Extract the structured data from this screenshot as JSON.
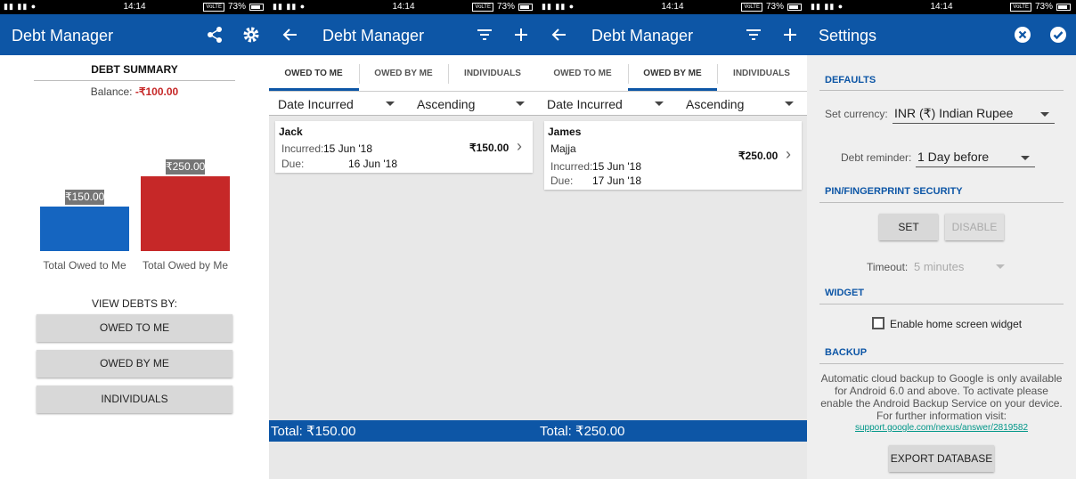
{
  "status_bar": {
    "time": "14:14",
    "battery": "73%",
    "volte": "VoLTE"
  },
  "summary_screen": {
    "app_title": "Debt Manager",
    "heading": "DEBT SUMMARY",
    "balance_label": "Balance:",
    "balance_value": "-₹100.00",
    "view_by_label": "VIEW DEBTS BY:",
    "buttons": [
      "OWED TO ME",
      "OWED BY ME",
      "INDIVIDUALS"
    ],
    "icons": [
      "share-icon",
      "gear-icon"
    ]
  },
  "chart_data": {
    "type": "bar",
    "categories": [
      "Total Owed to Me",
      "Total Owed by Me"
    ],
    "values": [
      150,
      250
    ],
    "value_labels": [
      "₹150.00",
      "₹250.00"
    ],
    "colors": [
      "#1565c0",
      "#c62828"
    ],
    "ylim": [
      0,
      250
    ],
    "grid": false
  },
  "list_screens": [
    {
      "app_title": "Debt Manager",
      "tabs": [
        "OWED TO ME",
        "OWED BY ME",
        "INDIVIDUALS"
      ],
      "active_tab": 0,
      "sort_field": "Date Incurred",
      "sort_order": "Ascending",
      "item": {
        "name": "Jack",
        "incurred_label": "Incurred:",
        "incurred": "15 Jun '18",
        "due_label": "Due:",
        "due": "16 Jun '18",
        "amount": "₹150.00"
      },
      "total": "Total: ₹150.00"
    },
    {
      "app_title": "Debt Manager",
      "tabs": [
        "OWED TO ME",
        "OWED BY ME",
        "INDIVIDUALS"
      ],
      "active_tab": 1,
      "sort_field": "Date Incurred",
      "sort_order": "Ascending",
      "item": {
        "name": "James",
        "note": "Majja",
        "incurred_label": "Incurred:",
        "incurred": "15 Jun '18",
        "due_label": "Due:",
        "due": "17 Jun '18",
        "amount": "₹250.00"
      },
      "total": "Total: ₹250.00"
    }
  ],
  "settings_screen": {
    "title": "Settings",
    "defaults_heading": "DEFAULTS",
    "currency_label": "Set currency:",
    "currency_value": "INR (₹) Indian Rupee",
    "reminder_label": "Debt reminder:",
    "reminder_value": "1 Day before",
    "security_heading": "PIN/FINGERPRINT SECURITY",
    "set_button": "SET",
    "disable_button": "DISABLE",
    "timeout_label": "Timeout:",
    "timeout_value": "5 minutes",
    "widget_heading": "WIDGET",
    "widget_checkbox_label": "Enable home screen widget",
    "widget_checked": false,
    "backup_heading": "BACKUP",
    "backup_text": "Automatic cloud backup to Google is only available for Android 6.0 and above. To activate please enable the Android Backup Service on your device. For further information visit:",
    "backup_link": "support.google.com/nexus/answer/2819582",
    "export_button": "EXPORT DATABASE"
  }
}
